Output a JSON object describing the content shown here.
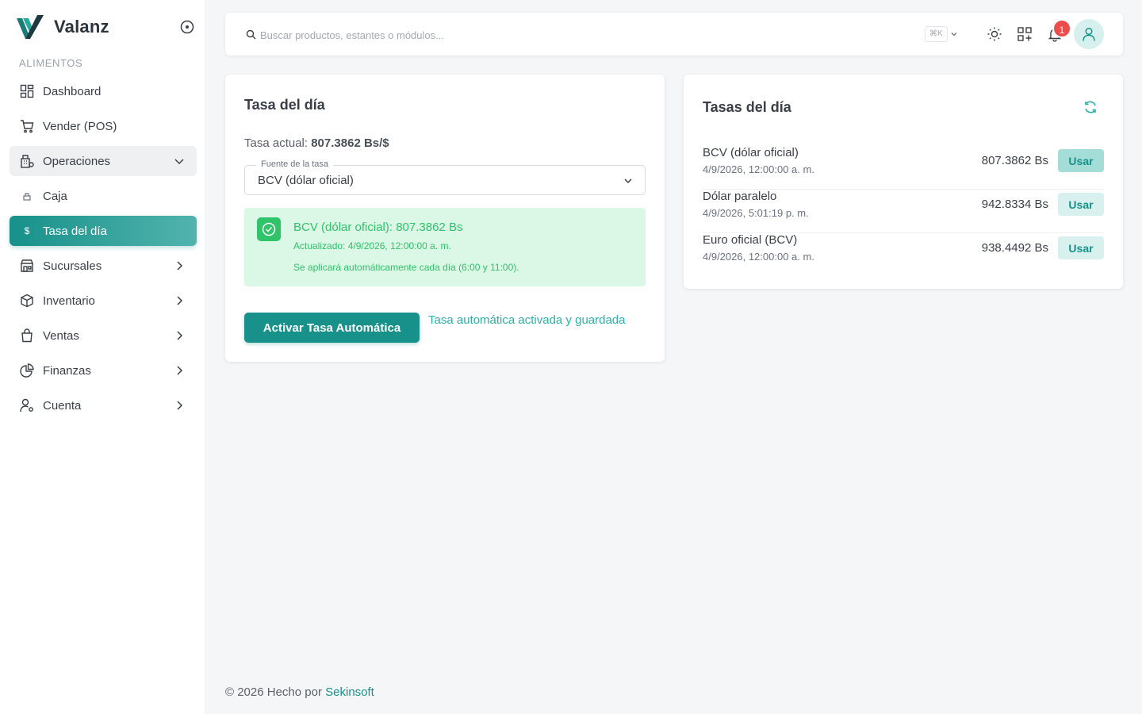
{
  "brand": {
    "name": "Valanz"
  },
  "sidebar": {
    "section": "ALIMENTOS",
    "items": [
      {
        "label": "Dashboard"
      },
      {
        "label": "Vender (POS)"
      },
      {
        "label": "Operaciones"
      },
      {
        "label": "Caja"
      },
      {
        "label": "Tasa del día"
      },
      {
        "label": "Sucursales"
      },
      {
        "label": "Inventario"
      },
      {
        "label": "Ventas"
      },
      {
        "label": "Finanzas"
      },
      {
        "label": "Cuenta"
      }
    ]
  },
  "topbar": {
    "search_placeholder": "Buscar productos, estantes o módulos...",
    "shortcut": "⌘K",
    "notifications_count": "1"
  },
  "rate_card": {
    "title": "Tasa del día",
    "current_label": "Tasa actual:",
    "current_value": "807.3862 Bs/$",
    "source_label": "Fuente de la tasa",
    "source_value": "BCV (dólar oficial)",
    "alert": {
      "title": "BCV (dólar oficial): 807.3862 Bs",
      "updated": "Actualizado: 4/9/2026, 12:00:00 a. m.",
      "note": "Se aplicará automáticamente cada día (6:00 y 11:00)."
    },
    "activate_button": "Activar Tasa Automática",
    "status": "Tasa automática activada y guardada"
  },
  "rates_card": {
    "title": "Tasas del día",
    "rows": [
      {
        "name": "BCV (dólar oficial)",
        "time": "4/9/2026, 12:00:00 a. m.",
        "value": "807.3862 Bs",
        "action": "Usar"
      },
      {
        "name": "Dólar paralelo",
        "time": "4/9/2026, 5:01:19 p. m.",
        "value": "942.8334 Bs",
        "action": "Usar"
      },
      {
        "name": "Euro oficial (BCV)",
        "time": "4/9/2026, 12:00:00 a. m.",
        "value": "938.4492 Bs",
        "action": "Usar"
      }
    ]
  },
  "footer": {
    "text": "© 2026 Hecho por",
    "link": "Sekinsoft"
  },
  "colors": {
    "primary": "#17918a",
    "success": "#2fc36a",
    "success_bg": "#dbf7e6",
    "danger": "#ee4b4b"
  }
}
